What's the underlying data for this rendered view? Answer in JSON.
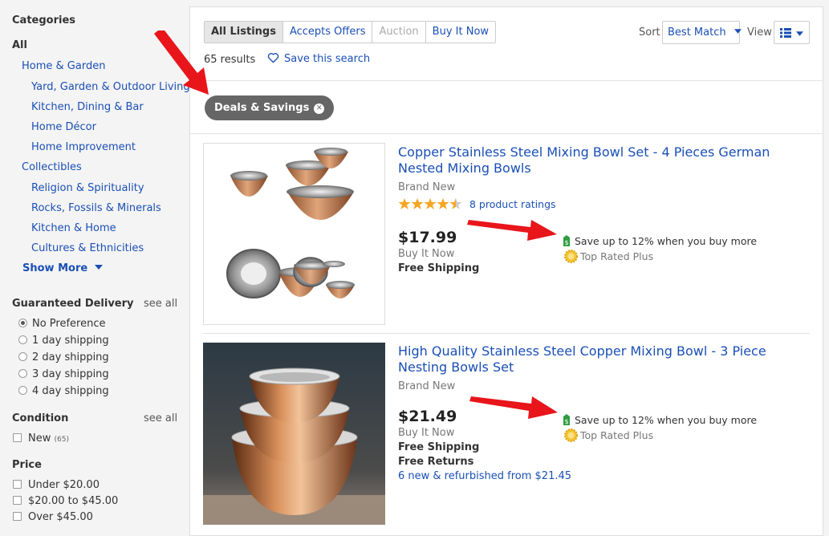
{
  "sidebar": {
    "categories_heading": "Categories",
    "all_label": "All",
    "categories": [
      {
        "label": "Home & Garden",
        "level": 1
      },
      {
        "label": "Yard, Garden & Outdoor Living",
        "level": 2
      },
      {
        "label": "Kitchen, Dining & Bar",
        "level": 2
      },
      {
        "label": "Home Décor",
        "level": 2
      },
      {
        "label": "Home Improvement",
        "level": 2
      },
      {
        "label": "Collectibles",
        "level": 1
      },
      {
        "label": "Religion & Spirituality",
        "level": 2
      },
      {
        "label": "Rocks, Fossils & Minerals",
        "level": 2
      },
      {
        "label": "Kitchen & Home",
        "level": 2
      },
      {
        "label": "Cultures & Ethnicities",
        "level": 2
      }
    ],
    "show_more": "Show More",
    "delivery": {
      "heading": "Guaranteed Delivery",
      "see_all": "see all",
      "options": [
        {
          "label": "No Preference",
          "selected": true
        },
        {
          "label": "1 day shipping",
          "selected": false
        },
        {
          "label": "2 day shipping",
          "selected": false
        },
        {
          "label": "3 day shipping",
          "selected": false
        },
        {
          "label": "4 day shipping",
          "selected": false
        }
      ]
    },
    "condition": {
      "heading": "Condition",
      "see_all": "see all",
      "options": [
        {
          "label": "New",
          "count": "(65)",
          "checked": false
        }
      ]
    },
    "price": {
      "heading": "Price",
      "options": [
        {
          "label": "Under $20.00",
          "checked": false
        },
        {
          "label": "$20.00 to $45.00",
          "checked": false
        },
        {
          "label": "Over $45.00",
          "checked": false
        }
      ]
    }
  },
  "toolbar": {
    "tabs": [
      {
        "label": "All Listings",
        "state": "active"
      },
      {
        "label": "Accepts Offers",
        "state": "normal"
      },
      {
        "label": "Auction",
        "state": "disabled"
      },
      {
        "label": "Buy It Now",
        "state": "normal"
      }
    ],
    "results": "65 results",
    "save_search": "Save this search",
    "sort_label": "Sort",
    "sort_value": "Best Match",
    "view_label": "View"
  },
  "filter_pill": {
    "label": "Deals & Savings"
  },
  "items": [
    {
      "title": "Copper Stainless Steel Mixing Bowl Set - 4 Pieces German Nested Mixing Bowls",
      "condition": "Brand New",
      "rating_stars": 4.5,
      "ratings": "8 product ratings",
      "price": "$17.99",
      "format": "Buy It Now",
      "shipping": "Free Shipping",
      "promo": "Save up to 12% when you buy more",
      "badge": "Top Rated Plus"
    },
    {
      "title": "High Quality Stainless Steel Copper Mixing Bowl - 3 Piece Nesting Bowls Set",
      "condition": "Brand New",
      "price": "$21.49",
      "format": "Buy It Now",
      "shipping": "Free Shipping",
      "returns": "Free Returns",
      "refurb": "6 new & refurbished from $21.45",
      "promo": "Save up to 12% when you buy more",
      "badge": "Top Rated Plus"
    }
  ],
  "colors": {
    "link": "#1a4fb5",
    "pill": "#666666",
    "arrow": "#e8151b",
    "star": "#f5a623",
    "promo_tag": "#2e9e3e",
    "copper": "#c98a5c"
  },
  "icons": [
    "heart-outline-icon",
    "caret-down-icon",
    "list-view-icon",
    "close-icon",
    "star-icon",
    "price-tag-icon",
    "top-rated-seal-icon",
    "red-arrow-annotation"
  ]
}
